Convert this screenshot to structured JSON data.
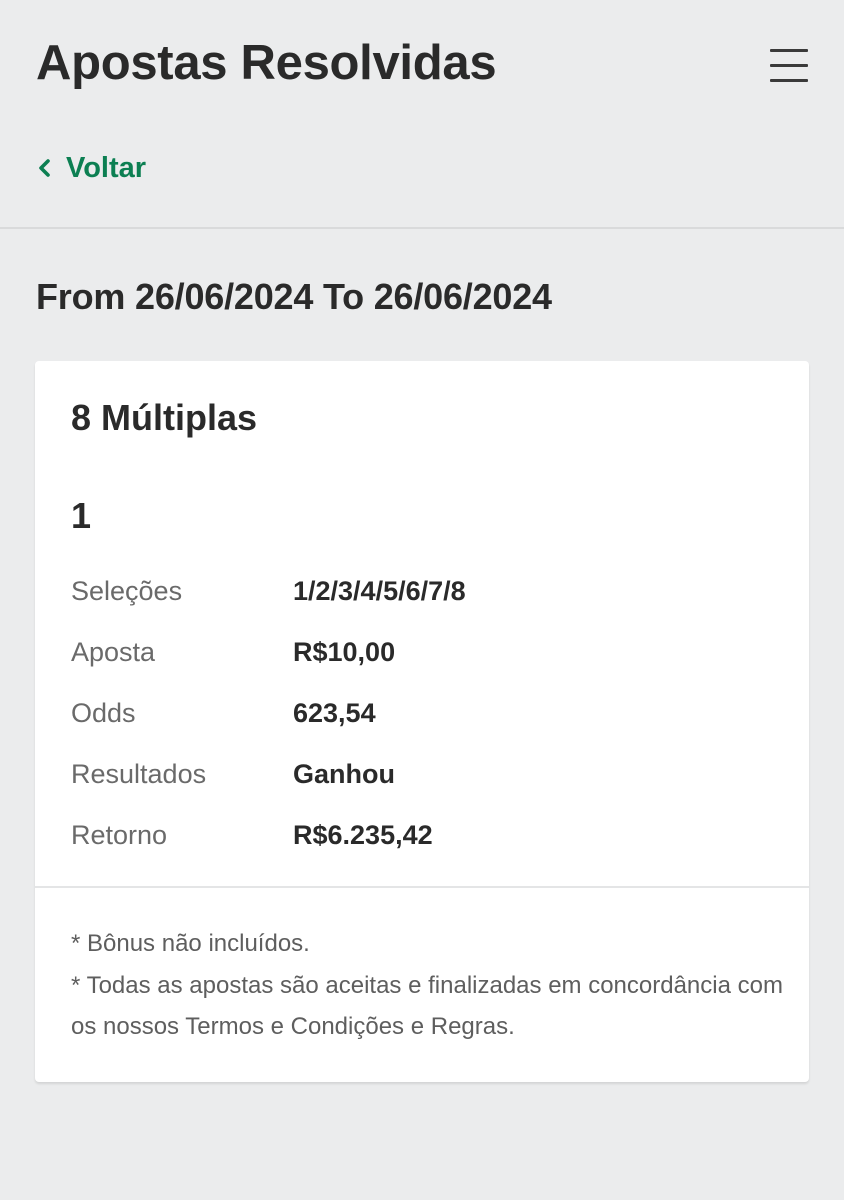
{
  "header": {
    "title": "Apostas Resolvidas",
    "back_label": "Voltar"
  },
  "date_range": "From 26/06/2024 To 26/06/2024",
  "bet": {
    "type": "8 Múltiplas",
    "number": "1",
    "details": [
      {
        "label": "Seleções",
        "value": "1/2/3/4/5/6/7/8"
      },
      {
        "label": "Aposta",
        "value": "R$10,00"
      },
      {
        "label": "Odds",
        "value": "623,54"
      },
      {
        "label": "Resultados",
        "value": "Ganhou"
      },
      {
        "label": "Retorno",
        "value": "R$6.235,42"
      }
    ]
  },
  "notes": [
    "* Bônus não incluídos.",
    "* Todas as apostas são aceitas e finalizadas em concordância com os nossos Termos e Condições e Regras."
  ],
  "icons": {
    "menu": "hamburger-menu-icon",
    "back": "chevron-left-icon"
  },
  "colors": {
    "accent": "#0c7f52",
    "background": "#ebeced",
    "card": "#ffffff"
  }
}
